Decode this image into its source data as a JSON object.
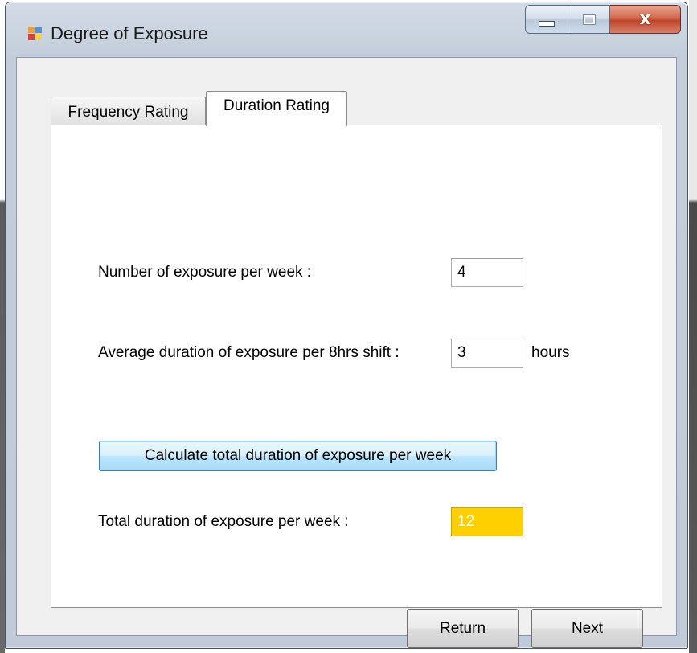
{
  "window": {
    "title": "Degree of Exposure",
    "icon": "application-icon",
    "controls": {
      "minimize_icon": "minimize-icon",
      "maximize_icon": "maximize-icon",
      "close_icon": "close-icon",
      "close_glyph": "x"
    }
  },
  "tabs": [
    {
      "label": "Frequency Rating",
      "selected": false
    },
    {
      "label": "Duration Rating",
      "selected": true
    }
  ],
  "form": {
    "exposures_label": "Number of exposure per week :",
    "exposures_value": "4",
    "avg_duration_label": "Average duration of exposure per 8hrs shift :",
    "avg_duration_value": "3",
    "avg_duration_unit": "hours",
    "calculate_label": "Calculate total duration of exposure per week",
    "total_label": "Total duration of exposure per week :",
    "total_value": "12"
  },
  "footer": {
    "return_label": "Return",
    "next_label": "Next"
  },
  "colors": {
    "result_background": "#ffd000",
    "focused_button": "#bee6fd",
    "close_button": "#c0452a"
  }
}
